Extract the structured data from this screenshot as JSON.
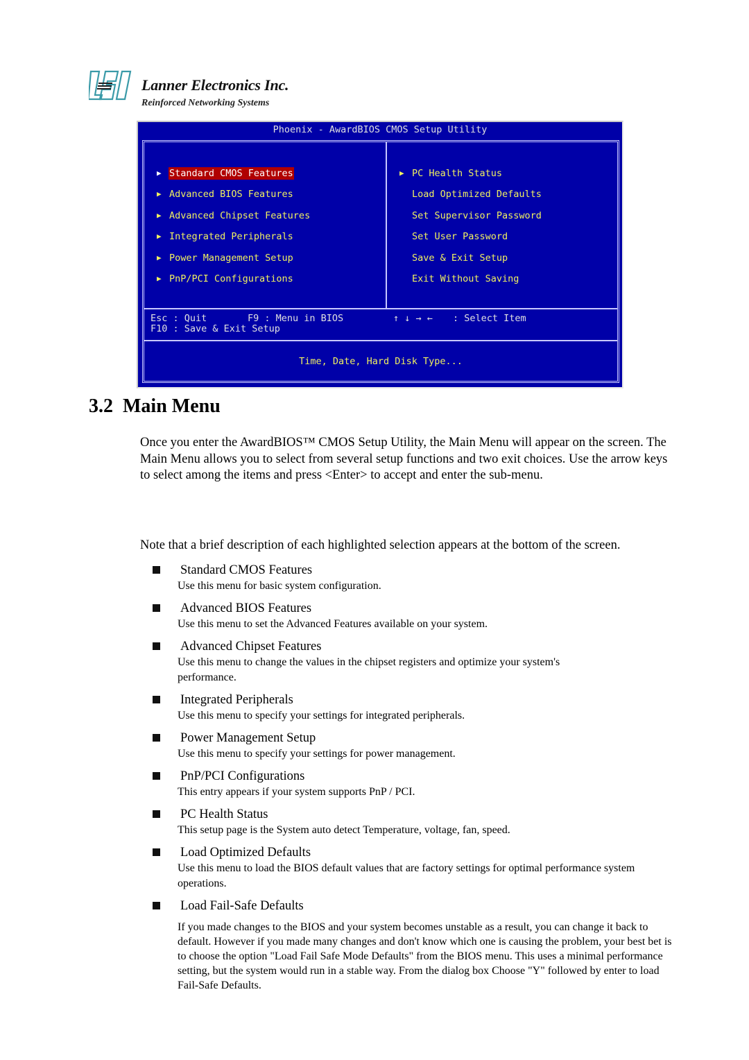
{
  "logo": {
    "mark_text": "LEI",
    "company": "Lanner Electronics Inc.",
    "tagline": "Reinforced Networking Systems"
  },
  "bios": {
    "title": "Phoenix - AwardBIOS CMOS Setup Utility",
    "colors": {
      "background": "#0000a8",
      "item": "#f0f060",
      "selected_bg": "#b00000",
      "frame": "#c8c8ff"
    },
    "left_menu": [
      {
        "label": "Standard CMOS Features",
        "submenu": true,
        "selected": true
      },
      {
        "label": "Advanced BIOS Features",
        "submenu": true
      },
      {
        "label": "Advanced Chipset Features",
        "submenu": true
      },
      {
        "label": "Integrated Peripherals",
        "submenu": true
      },
      {
        "label": "Power Management Setup",
        "submenu": true
      },
      {
        "label": "PnP/PCI Configurations",
        "submenu": true
      }
    ],
    "right_menu": [
      {
        "label": "PC Health Status",
        "submenu": true
      },
      {
        "label": "Load Optimized Defaults",
        "submenu": false
      },
      {
        "label": "Set Supervisor Password",
        "submenu": false
      },
      {
        "label": "Set User Password",
        "submenu": false
      },
      {
        "label": "Save & Exit Setup",
        "submenu": false
      },
      {
        "label": "Exit Without Saving",
        "submenu": false
      }
    ],
    "keys": {
      "esc": "Esc : Quit",
      "f9": "F9 : Menu in BIOS",
      "arrows": "↑ ↓ → ←",
      "select": ": Select Item",
      "f10": "F10 : Save & Exit Setup"
    },
    "help": "Time, Date, Hard Disk Type..."
  },
  "section": {
    "heading": "3.2  Main Menu",
    "intro": "Once you enter the AwardBIOS™ CMOS Setup Utility, the Main Menu will appear on the screen. The Main Menu allows you to select from several setup functions and two exit choices. Use the arrow keys to select among the items and press <Enter> to accept and enter the sub-menu.",
    "note": "Note that a brief description of each highlighted selection appears at the bottom of the screen.",
    "items": [
      {
        "title": "Standard CMOS Features",
        "desc": "Use this menu for basic system configuration."
      },
      {
        "title": "Advanced BIOS Features",
        "desc": "Use this menu to set the Advanced Features available on your system."
      },
      {
        "title": "Advanced Chipset Features",
        "desc": "Use this menu to change the values in the chipset registers and optimize your system's performance."
      },
      {
        "title": "Integrated Peripherals",
        "desc": "Use this menu to specify your settings for integrated peripherals."
      },
      {
        "title": "Power Management Setup",
        "desc": "Use this menu to specify your settings for power management."
      },
      {
        "title": "PnP/PCI Configurations",
        "desc": "This entry appears if your system supports PnP / PCI."
      },
      {
        "title": "PC Health Status",
        "desc": "This setup page is the System auto detect Temperature, voltage, fan, speed."
      },
      {
        "title": "Load Optimized Defaults",
        "desc": "Use this menu to load the BIOS default values that are factory settings for optimal performance system operations."
      },
      {
        "title": "Load Fail-Safe Defaults",
        "desc": "If you made changes to the BIOS and your system becomes unstable as a result, you can change it back to default. However if you made many changes and don't know which one is causing the problem, your best bet is to choose the option \"Load Fail Safe Mode Defaults\" from the BIOS menu. This uses a minimal performance setting, but the system would run in a stable way. From the dialog box Choose \"Y\" followed by enter to load Fail-Safe Defaults."
      }
    ]
  }
}
